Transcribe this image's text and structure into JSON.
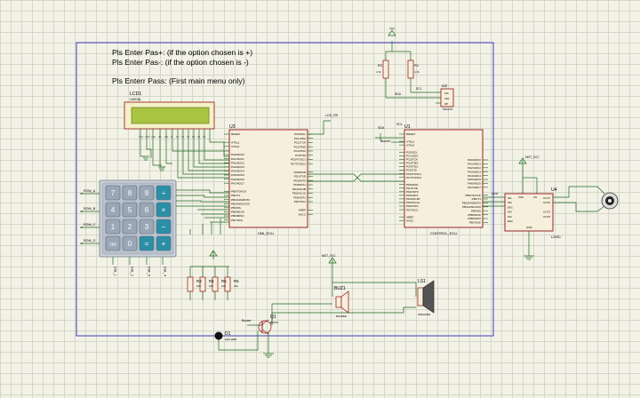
{
  "notes": [
    "Pls Enter Pas+: (if the option chosen is +)",
    "Pls Enter Pas-: (if the option chosen is -)",
    "Pls Enterr Pass: (First main menu only)"
  ],
  "lcd": {
    "ref": "LCD1",
    "part": "LM016L"
  },
  "mcu_left": {
    "ref": "U3",
    "name": "HMI_ECU",
    "pins_left": [
      "RESET",
      "",
      "XTAL1",
      "XTAL2",
      "",
      "PA0/ADC0",
      "PA1/ADC1",
      "PA2/ADC2",
      "PA3/ADC3",
      "PA4/ADC4",
      "PA5/ADC5",
      "PA6/ADC6",
      "PA7/ADC7",
      "",
      "PB0/T0/XCK",
      "PB1/T1",
      "PB2/AIN0/INT2",
      "PB3/AIN1/OC0",
      "PB4/SS",
      "PB5/MOSI",
      "PB6/MISO",
      "PB7/SCK"
    ],
    "pins_right": [
      "PC0/SCL",
      "PC1/SDA",
      "PC2/TCK",
      "PC3/TMS",
      "PC4/TDO",
      "PC5/TDI",
      "PC6/TOSC1",
      "PC7/TOSC2",
      "",
      "PD0/RXD",
      "PD1/TXD",
      "PD2/INT0",
      "PD3/INT1",
      "PD4/OC1B",
      "PD5/OC1A",
      "PD6/ICP1",
      "PD7/OC2",
      "",
      "AREF",
      "AVCC"
    ]
  },
  "mcu_right": {
    "ref": "U1",
    "name": "CONTROL_ECU",
    "pins_left": [
      "RESET",
      "",
      "XTAL1",
      "XTAL2",
      "",
      "PC0/SCL",
      "PC1/SDA",
      "PC2/TCK",
      "PC3/TMS",
      "PC4/TDO",
      "PC5/TDI",
      "PC6/TOSC1",
      "PC7/TOSC2",
      "",
      "PD0/RXD",
      "PD1/TXD",
      "PD2/INT0",
      "PD3/INT1",
      "PD4/OC1B",
      "PD5/OC1A",
      "PD6/ICP1",
      "PD7/OC2",
      "",
      "AREF",
      "AVCC"
    ],
    "pins_right": [
      "PA0/ADC0",
      "PA1/ADC1",
      "PA2/ADC2",
      "PA3/ADC3",
      "PA4/ADC4",
      "PA5/ADC5",
      "PA6/ADC6",
      "PA7/ADC7",
      "",
      "PB0/T0/XCK",
      "PB1/T1",
      "PB2/AIN0/INT2",
      "PB3/AIN1/OC0",
      "PB4/SS",
      "PB5/MOSI",
      "PB6/MISO",
      "PB7/SCK"
    ]
  },
  "eeprom": {
    "ref": "U2",
    "part": "M24C16",
    "pins": [
      "SCL",
      "SDA",
      "WP"
    ]
  },
  "resistors_top": [
    {
      "ref": "R2",
      "value": "4.7k"
    },
    {
      "ref": "R1",
      "value": "4.7k"
    }
  ],
  "resistors_bottom": [
    {
      "ref": "R3",
      "value": "10k"
    },
    {
      "ref": "R4",
      "value": "10k"
    },
    {
      "ref": "R5",
      "value": "10k"
    },
    {
      "ref": "R6",
      "value": "10k"
    }
  ],
  "driver": {
    "ref": "U4",
    "part": "L293D",
    "pins_left": [
      "IN1",
      "IN2",
      "EN1",
      "IN3",
      "IN4",
      "EN2"
    ],
    "pins_right": [
      "OUT1",
      "OUT2",
      "",
      "OUT3",
      "OUT4"
    ],
    "top_pins": [
      "VSS",
      "VS"
    ],
    "bottom_pin": "GND"
  },
  "buzzer": {
    "ref": "BUZ1",
    "part": "BUZZER"
  },
  "speaker": {
    "ref": "LS1",
    "part": "SPEAKER"
  },
  "transistor": {
    "ref": "Q1",
    "part": "BC547"
  },
  "led": {
    "ref": "D1",
    "part": "LED-RED"
  },
  "keypad": {
    "keys": [
      "7",
      "8",
      "9",
      "÷",
      "4",
      "5",
      "6",
      "×",
      "1",
      "2",
      "3",
      "−",
      "ON",
      "0",
      "=",
      "+"
    ],
    "rows": [
      "ROW_A",
      "ROW_B",
      "ROW_C",
      "ROW_D"
    ],
    "cols": [
      "COL_1",
      "COL_2",
      "COL_3",
      "COL_4"
    ]
  },
  "net_labels": {
    "lcd_rs": "LCD_RS",
    "scl": "SCL",
    "sda": "SDA",
    "buzzer": "Buzzer",
    "buzzer2": "Buzzer",
    "pwm": "PWM",
    "nc": "NC"
  },
  "power": {
    "vcc": "VCC",
    "mot_vcc": "MOT_VCC"
  },
  "colors": {
    "background": "#f2f2e6",
    "grid": "#d5d5c8",
    "frame": "#3f3fbf",
    "chip": "#8f1010",
    "chip_fill": "#f7efdc",
    "wire": "#1f6a1f",
    "lcd": "#a9c441",
    "key": "#9aa7b7",
    "key_op": "#2b8fa6"
  }
}
